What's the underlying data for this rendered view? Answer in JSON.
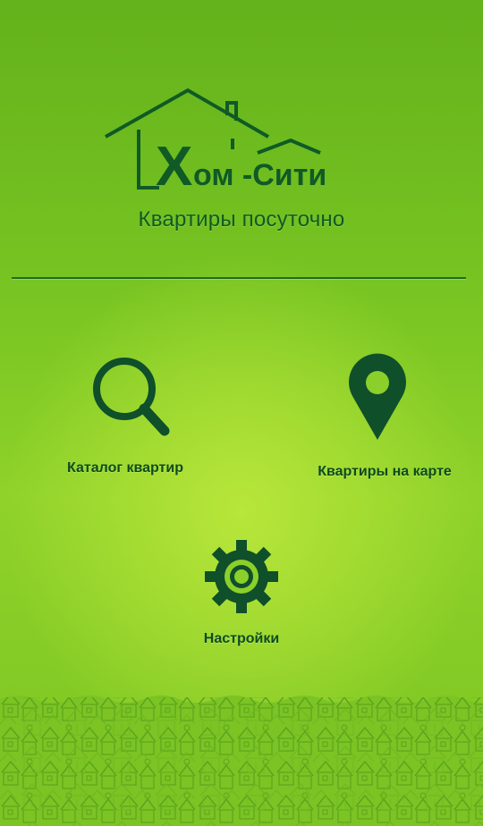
{
  "brand": {
    "logo_x": "Х",
    "logo_rest": "ом -Сити",
    "tagline": "Квартиры посуточно"
  },
  "menu": {
    "catalog_label": "Каталог квартир",
    "map_label": "Квартиры на карте",
    "settings_label": "Настройки"
  },
  "colors": {
    "background": "#7cc522",
    "icon": "#0f4f2a",
    "text": "#0e4a1f"
  },
  "icons": {
    "catalog": "search-icon",
    "map": "map-pin-icon",
    "settings": "gear-icon"
  }
}
